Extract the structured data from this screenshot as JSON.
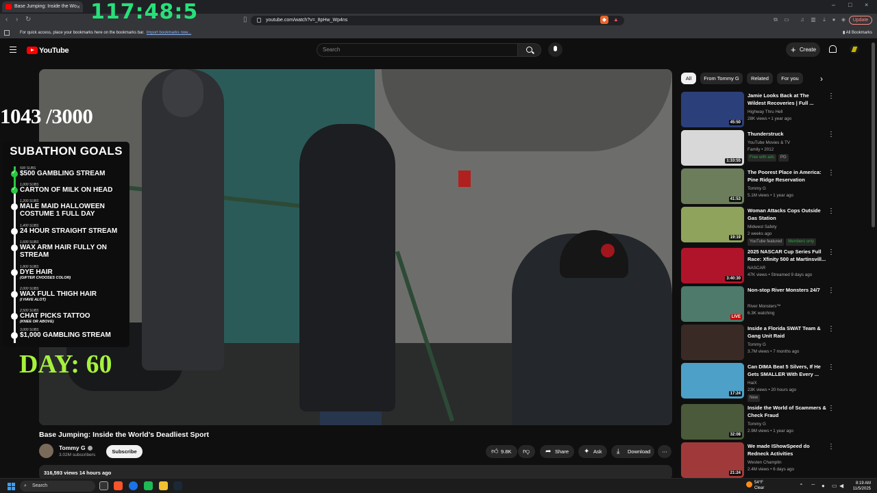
{
  "browser": {
    "tab_title": "Base Jumping: Inside the Wo",
    "url": "youtube.com/watch?v=_8pHw_Wp4ns",
    "bookmarks_hint": "For quick access, place your bookmarks here on the bookmarks bar.",
    "bookmarks_link": "Import bookmarks now...",
    "all_bookmarks": "All Bookmarks",
    "update_label": "Update"
  },
  "yt": {
    "logo_text": "YouTube",
    "search_placeholder": "Search",
    "create_label": "Create"
  },
  "overlay": {
    "timer": "117:48:5",
    "sub_count": "1043 /3000",
    "goals_title": "SUBATHON GOALS",
    "day": "DAY: 60",
    "goals": [
      {
        "subs": "500 SUBS",
        "name": "$500 GAMBLING STREAM",
        "note": "",
        "done": true
      },
      {
        "subs": "1,000 SUBS",
        "name": "CARTON OF MILK ON HEAD",
        "note": "",
        "done": true
      },
      {
        "subs": "1,200 SUBS",
        "name": "MALE MAID HALLOWEEN COSTUME 1 FULL DAY",
        "note": "",
        "done": false
      },
      {
        "subs": "1,400 SUBS",
        "name": "24 HOUR STRAIGHT STREAM",
        "note": "",
        "done": false
      },
      {
        "subs": "1,600 SUBS",
        "name": "WAX ARM HAIR FULLY ON STREAM",
        "note": "",
        "done": false
      },
      {
        "subs": "1,800 SUBS",
        "name": "DYE HAIR",
        "note": "(GIFTER CHOOSES COLOR)",
        "done": false
      },
      {
        "subs": "2,000 SUBS",
        "name": "WAX FULL THIGH HAIR",
        "note": "(I HAVE ALOT)",
        "done": false
      },
      {
        "subs": "2,500 SUBS",
        "name": "CHAT PICKS TATTOO",
        "note": "(KNEE OR ABOVE)",
        "done": false
      },
      {
        "subs": "3,000 SUBS",
        "name": "$1,000 GAMBLING STREAM",
        "note": "",
        "done": false
      }
    ]
  },
  "video": {
    "title": "Base Jumping: Inside the World’s Deadliest Sport",
    "channel": "Tommy G",
    "subscribers": "3.02M subscribers",
    "subscribe_label": "Subscribe",
    "likes": "9.8K",
    "share_label": "Share",
    "ask_label": "Ask",
    "download_label": "Download",
    "views_date": "316,593 views  14 hours ago"
  },
  "chips": [
    "All",
    "From Tommy G",
    "Related",
    "For you"
  ],
  "recommendations": [
    {
      "title": "Jamie Looks Back at The Wildest Recoveries | Full ...",
      "channel": "Highway Thru Hell",
      "meta": "28K views • 1 year ago",
      "duration": "45:50",
      "badges": [],
      "thumb": "#2b3f7a"
    },
    {
      "title": "Thunderstruck",
      "channel": "YouTube Movies & TV",
      "meta": "Family • 2012",
      "duration": "1:33:55",
      "badges": [
        "Free with ads",
        "PG"
      ],
      "thumb": "#d8d8d8"
    },
    {
      "title": "The Poorest Place in America: Pine Ridge Reservation",
      "channel": "Tommy G",
      "meta": "5.1M views • 1 year ago",
      "duration": "41:53",
      "badges": [],
      "thumb": "#6b7d5a"
    },
    {
      "title": "Woman Attacks Cops Outside Gas Station",
      "channel": "Midwest Safety",
      "meta": "2 weeks ago",
      "duration": "19:19",
      "badges": [
        "YouTube featured",
        "Members only"
      ],
      "thumb": "#8fa35c"
    },
    {
      "title": "2025 NASCAR Cup Series Full Race: Xfinity 500 at Martinsvill...",
      "channel": "NASCAR",
      "meta": "47K views • Streamed 9 days ago",
      "duration": "3:40:30",
      "badges": [],
      "thumb": "#b0142a"
    },
    {
      "title": "Non-stop River Monsters 24/7",
      "channel": "River Monsters™",
      "meta": "6.3K watching",
      "duration": "LIVE",
      "badges": [],
      "thumb": "#4d7a6a"
    },
    {
      "title": "Inside a Florida SWAT Team & Gang Unit Raid",
      "channel": "Tommy G",
      "meta": "3.7M views • 7 months ago",
      "duration": "",
      "badges": [],
      "thumb": "#3a2a25"
    },
    {
      "title": "Can DIMA Beat 5 Silvers, If He Gets SMALLER With Every ...",
      "channel": "HaiX",
      "meta": "23K views • 20 hours ago",
      "duration": "17:24",
      "badges": [
        "New"
      ],
      "thumb": "#4da0c8"
    },
    {
      "title": "Inside the World of Scammers & Check Fraud",
      "channel": "Tommy G",
      "meta": "2.9M views • 1 year ago",
      "duration": "32:08",
      "badges": [],
      "thumb": "#4a5a3a"
    },
    {
      "title": "We made IShowSpeed do Redneck Activities",
      "channel": "Westen Champlin",
      "meta": "2.4M views • 6 days ago",
      "duration": "21:24",
      "badges": [],
      "thumb": "#a03a3a"
    }
  ],
  "taskbar": {
    "search_label": "Search",
    "temp": "54°F",
    "weather": "Clear",
    "time": "8:19 AM",
    "date": "11/5/2025"
  }
}
